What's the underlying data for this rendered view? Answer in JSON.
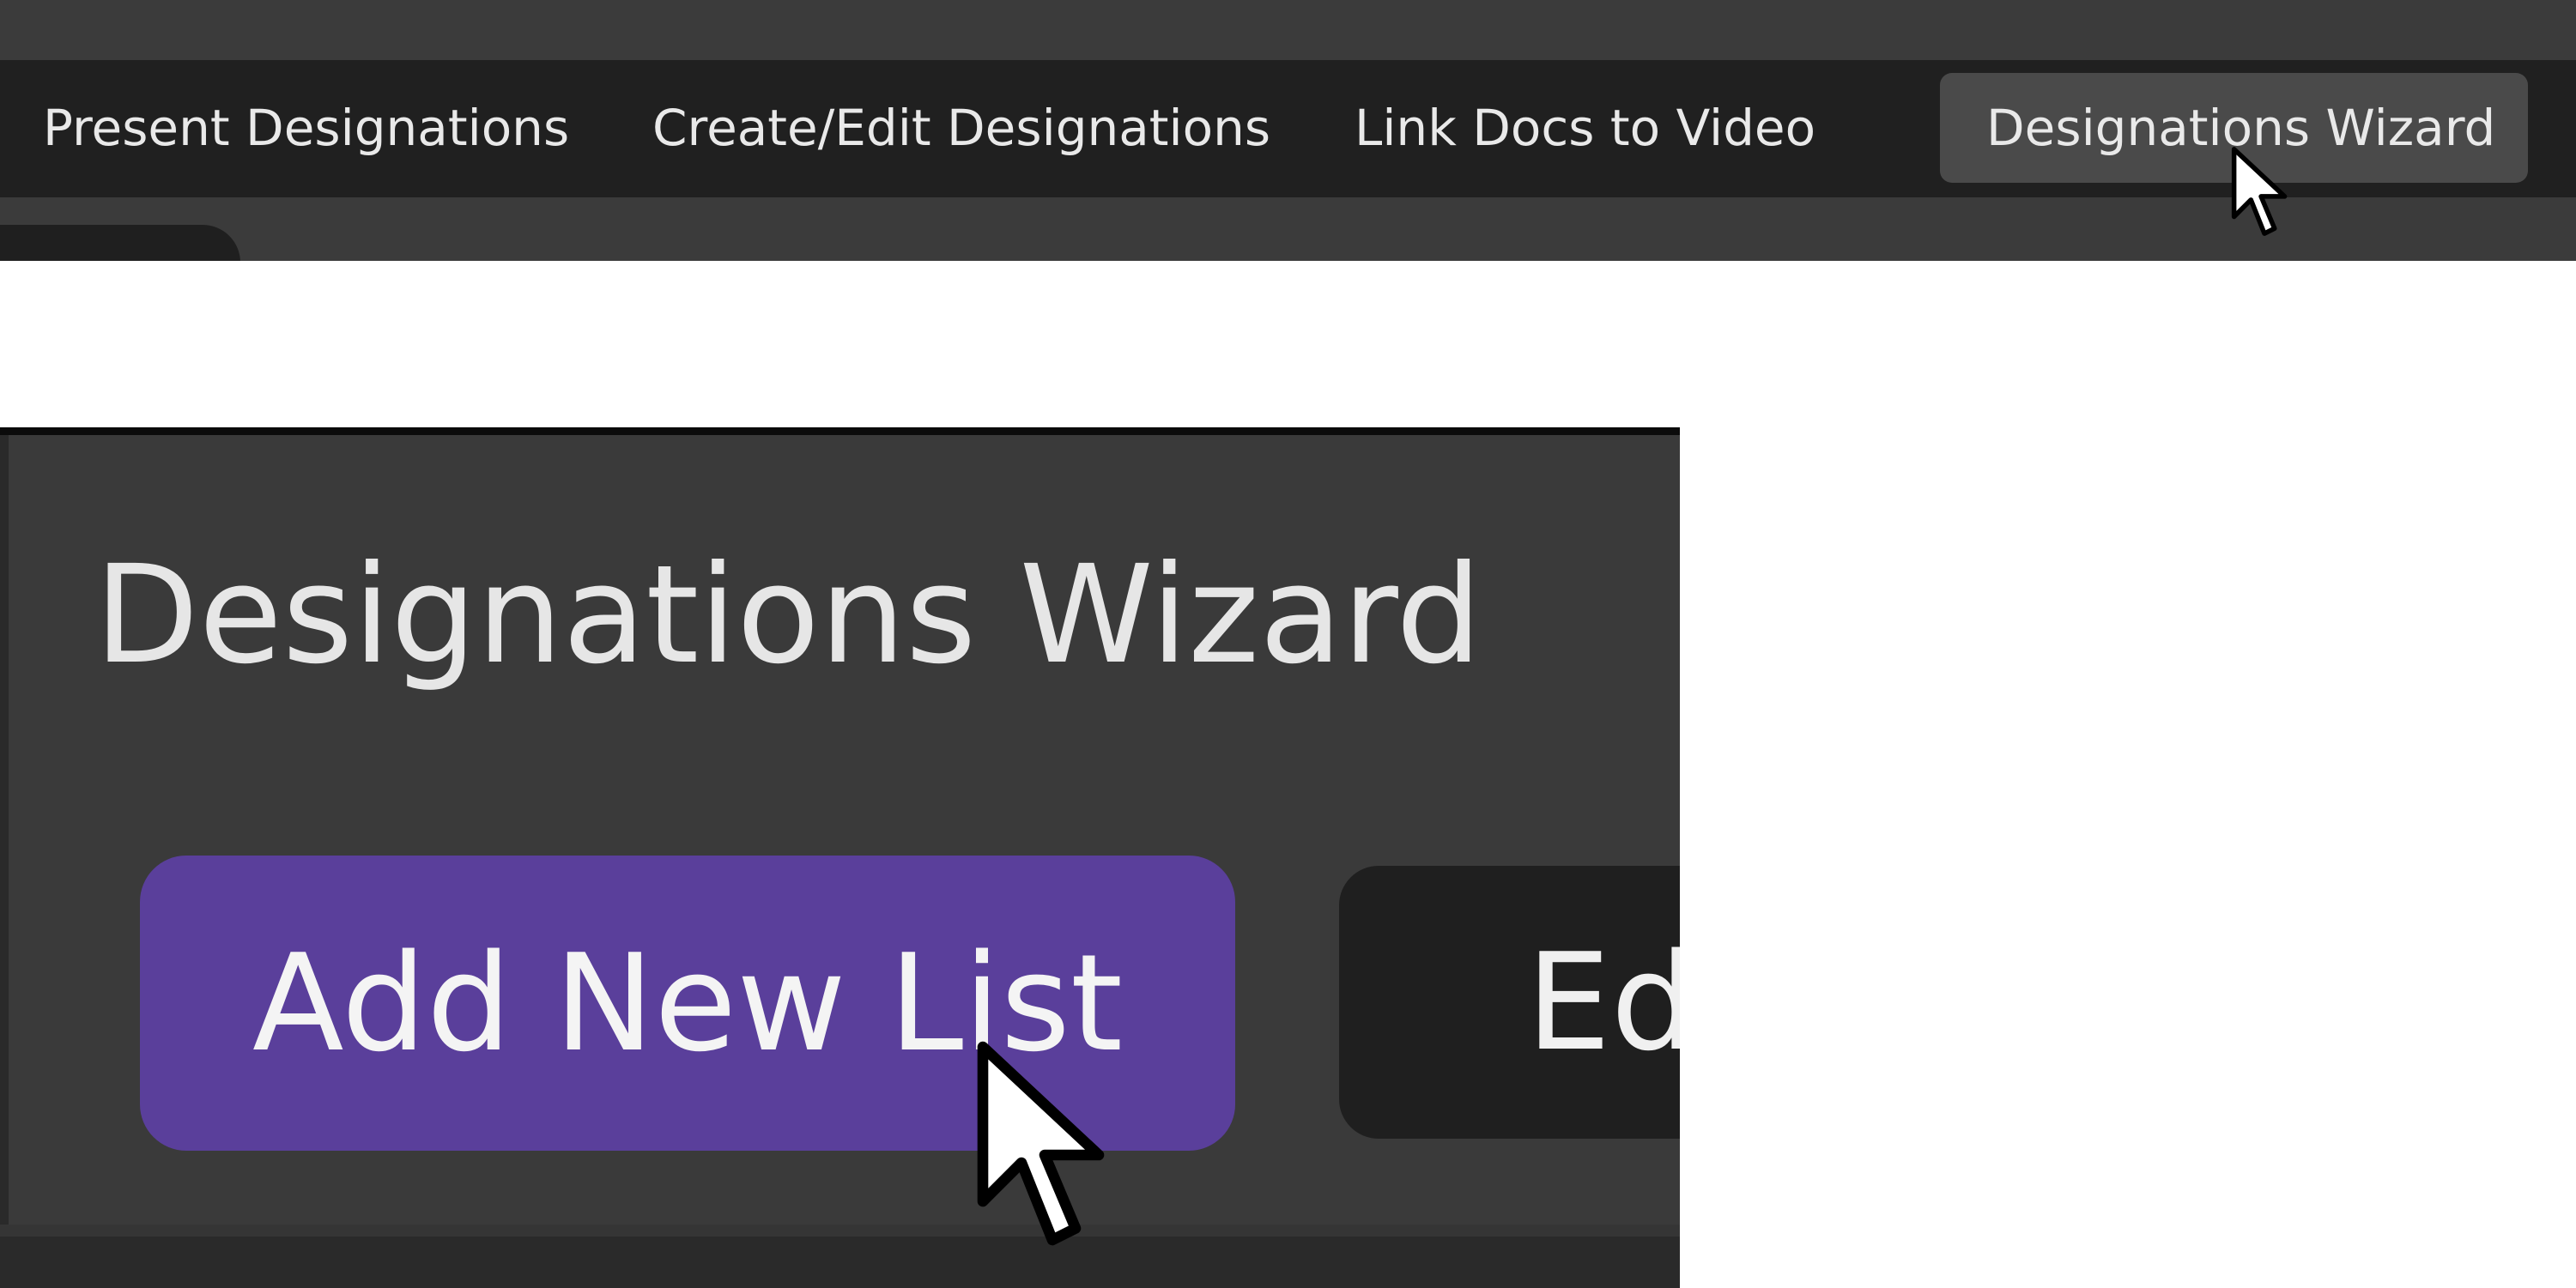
{
  "menu": {
    "items": [
      {
        "label": "Present Designations"
      },
      {
        "label": "Create/Edit Designations"
      },
      {
        "label": "Link Docs to Video"
      },
      {
        "label": "Designations Wizard",
        "active": true
      }
    ]
  },
  "wizard": {
    "title": "Designations Wizard",
    "add_list_label": "Add New List",
    "edit_label_partial": "Ed"
  },
  "colors": {
    "menu_bar": "#202020",
    "active_menu_item": "#4a4a4a",
    "panel_background": "#3a3a3a",
    "primary_button": "#5a3f9b",
    "secondary_button": "#1f1f1f"
  },
  "icons": {
    "cursor": "mouse-pointer-arrow"
  }
}
